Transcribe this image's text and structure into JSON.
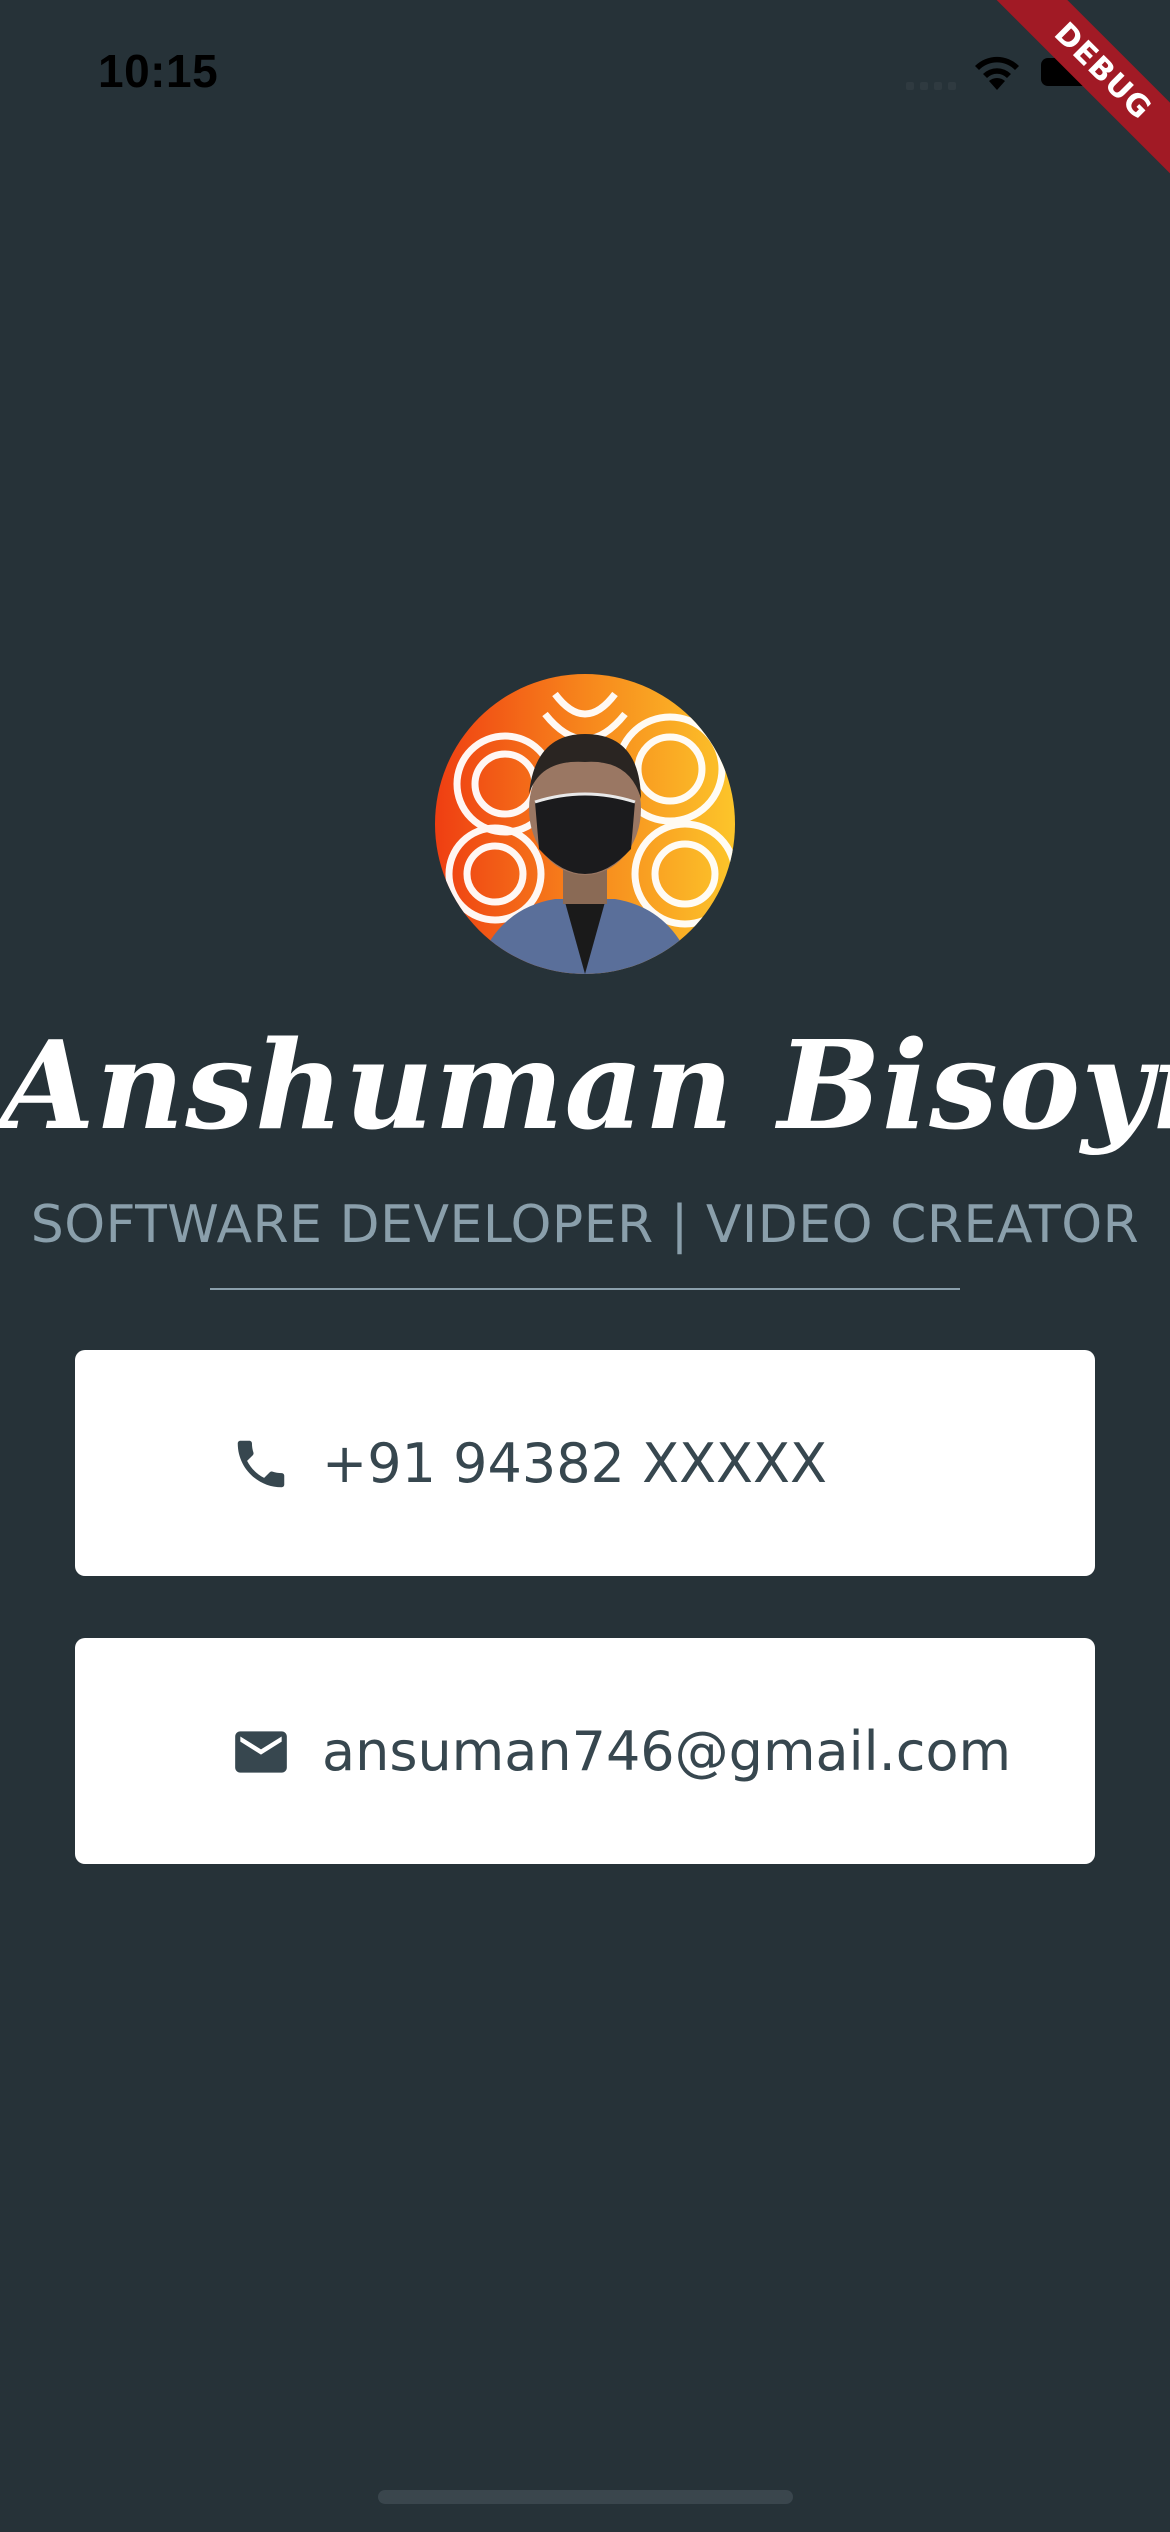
{
  "status_bar": {
    "time": "10:15",
    "icons": [
      "cellular-signal-icon",
      "wifi-icon",
      "battery-icon"
    ]
  },
  "debug_banner": {
    "label": "DEBUG",
    "color": "#a11a25"
  },
  "profile": {
    "avatar_icon": "profile-photo",
    "name": "Anshuman Bisoyi",
    "role": "SOFTWARE DEVELOPER | VIDEO CREATOR"
  },
  "contacts": {
    "phone": {
      "icon": "phone-icon",
      "value": "+91 94382 XXXXX"
    },
    "email": {
      "icon": "mail-icon",
      "value": "ansuman746@gmail.com"
    }
  },
  "colors": {
    "background": "#263238",
    "card": "#ffffff",
    "card_text": "#37474f",
    "role_text": "#8a9fab"
  }
}
